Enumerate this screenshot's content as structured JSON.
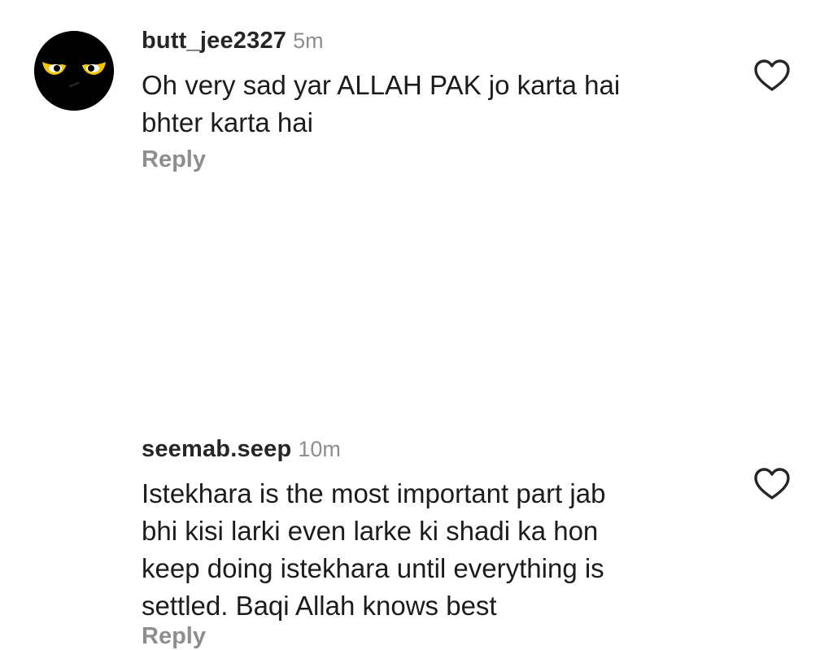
{
  "comments": [
    {
      "username": "butt_jee2327",
      "time": "5m",
      "text": "Oh very sad yar ALLAH PAK jo karta hai\nbhter karta hai",
      "reply_label": "Reply",
      "avatar_icon": "angry-eyes-avatar",
      "like_icon": "heart-outline-icon"
    },
    {
      "username": "seemab.seep",
      "time": "10m",
      "text": "Istekhara is the most important part jab\nbhi kisi larki even larke ki shadi ka hon\nkeep doing istekhara until everything is\nsettled. Baqi Allah knows best",
      "reply_label": "Reply",
      "like_icon": "heart-outline-icon"
    }
  ],
  "colors": {
    "username": "#262626",
    "meta": "#8e8e8e",
    "text": "#1c1c1c",
    "avatar_bg": "#000000",
    "avatar_eyes": "#f2c500"
  }
}
